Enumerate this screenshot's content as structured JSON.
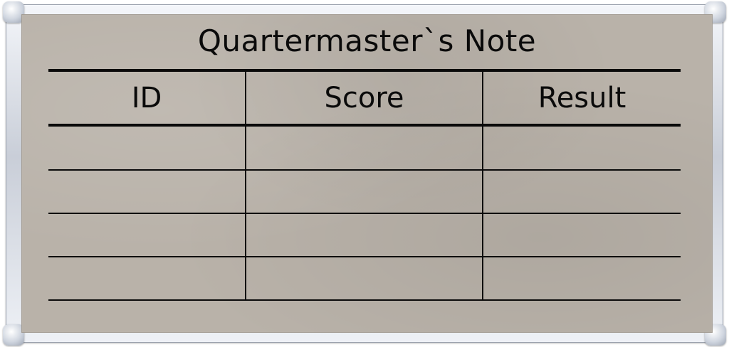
{
  "note": {
    "title": "Quartermaster`s Note",
    "columns": [
      "ID",
      "Score",
      "Result"
    ],
    "rows": [
      [
        "",
        "",
        ""
      ],
      [
        "",
        "",
        ""
      ],
      [
        "",
        "",
        ""
      ],
      [
        "",
        "",
        ""
      ]
    ]
  },
  "colors": {
    "board_surface": "#b9b2a9",
    "ink": "#0a0a0a",
    "frame": "#c9ced8"
  }
}
